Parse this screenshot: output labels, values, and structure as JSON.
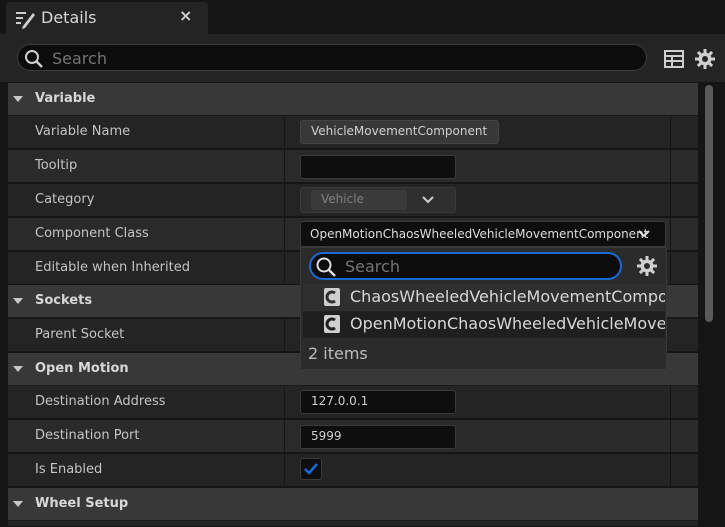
{
  "tab": {
    "title": "Details",
    "close": "×"
  },
  "search": {
    "placeholder": "Search"
  },
  "sections": {
    "variable": "Variable",
    "sockets": "Sockets",
    "open_motion": "Open Motion",
    "wheel_setup": "Wheel Setup"
  },
  "properties": {
    "variable_name": {
      "label": "Variable Name",
      "value": "VehicleMovementComponent"
    },
    "tooltip": {
      "label": "Tooltip",
      "value": ""
    },
    "category": {
      "label": "Category",
      "value": "Vehicle"
    },
    "component_class": {
      "label": "Component Class",
      "value": "OpenMotionChaosWheeledVehicleMovementComponent"
    },
    "editable_when_inherited": {
      "label": "Editable when Inherited"
    },
    "parent_socket": {
      "label": "Parent Socket"
    },
    "destination_address": {
      "label": "Destination Address",
      "value": "127.0.0.1"
    },
    "destination_port": {
      "label": "Destination Port",
      "value": "5999"
    },
    "is_enabled": {
      "label": "Is Enabled",
      "checked": true
    }
  },
  "class_picker": {
    "search_placeholder": "Search",
    "items": [
      "ChaosWheeledVehicleMovementComponent",
      "OpenMotionChaosWheeledVehicleMovementComponent"
    ],
    "count_text": "2 items"
  },
  "colors": {
    "accent": "#1a6ad6",
    "panel": "#242424",
    "category_header": "#383838"
  }
}
